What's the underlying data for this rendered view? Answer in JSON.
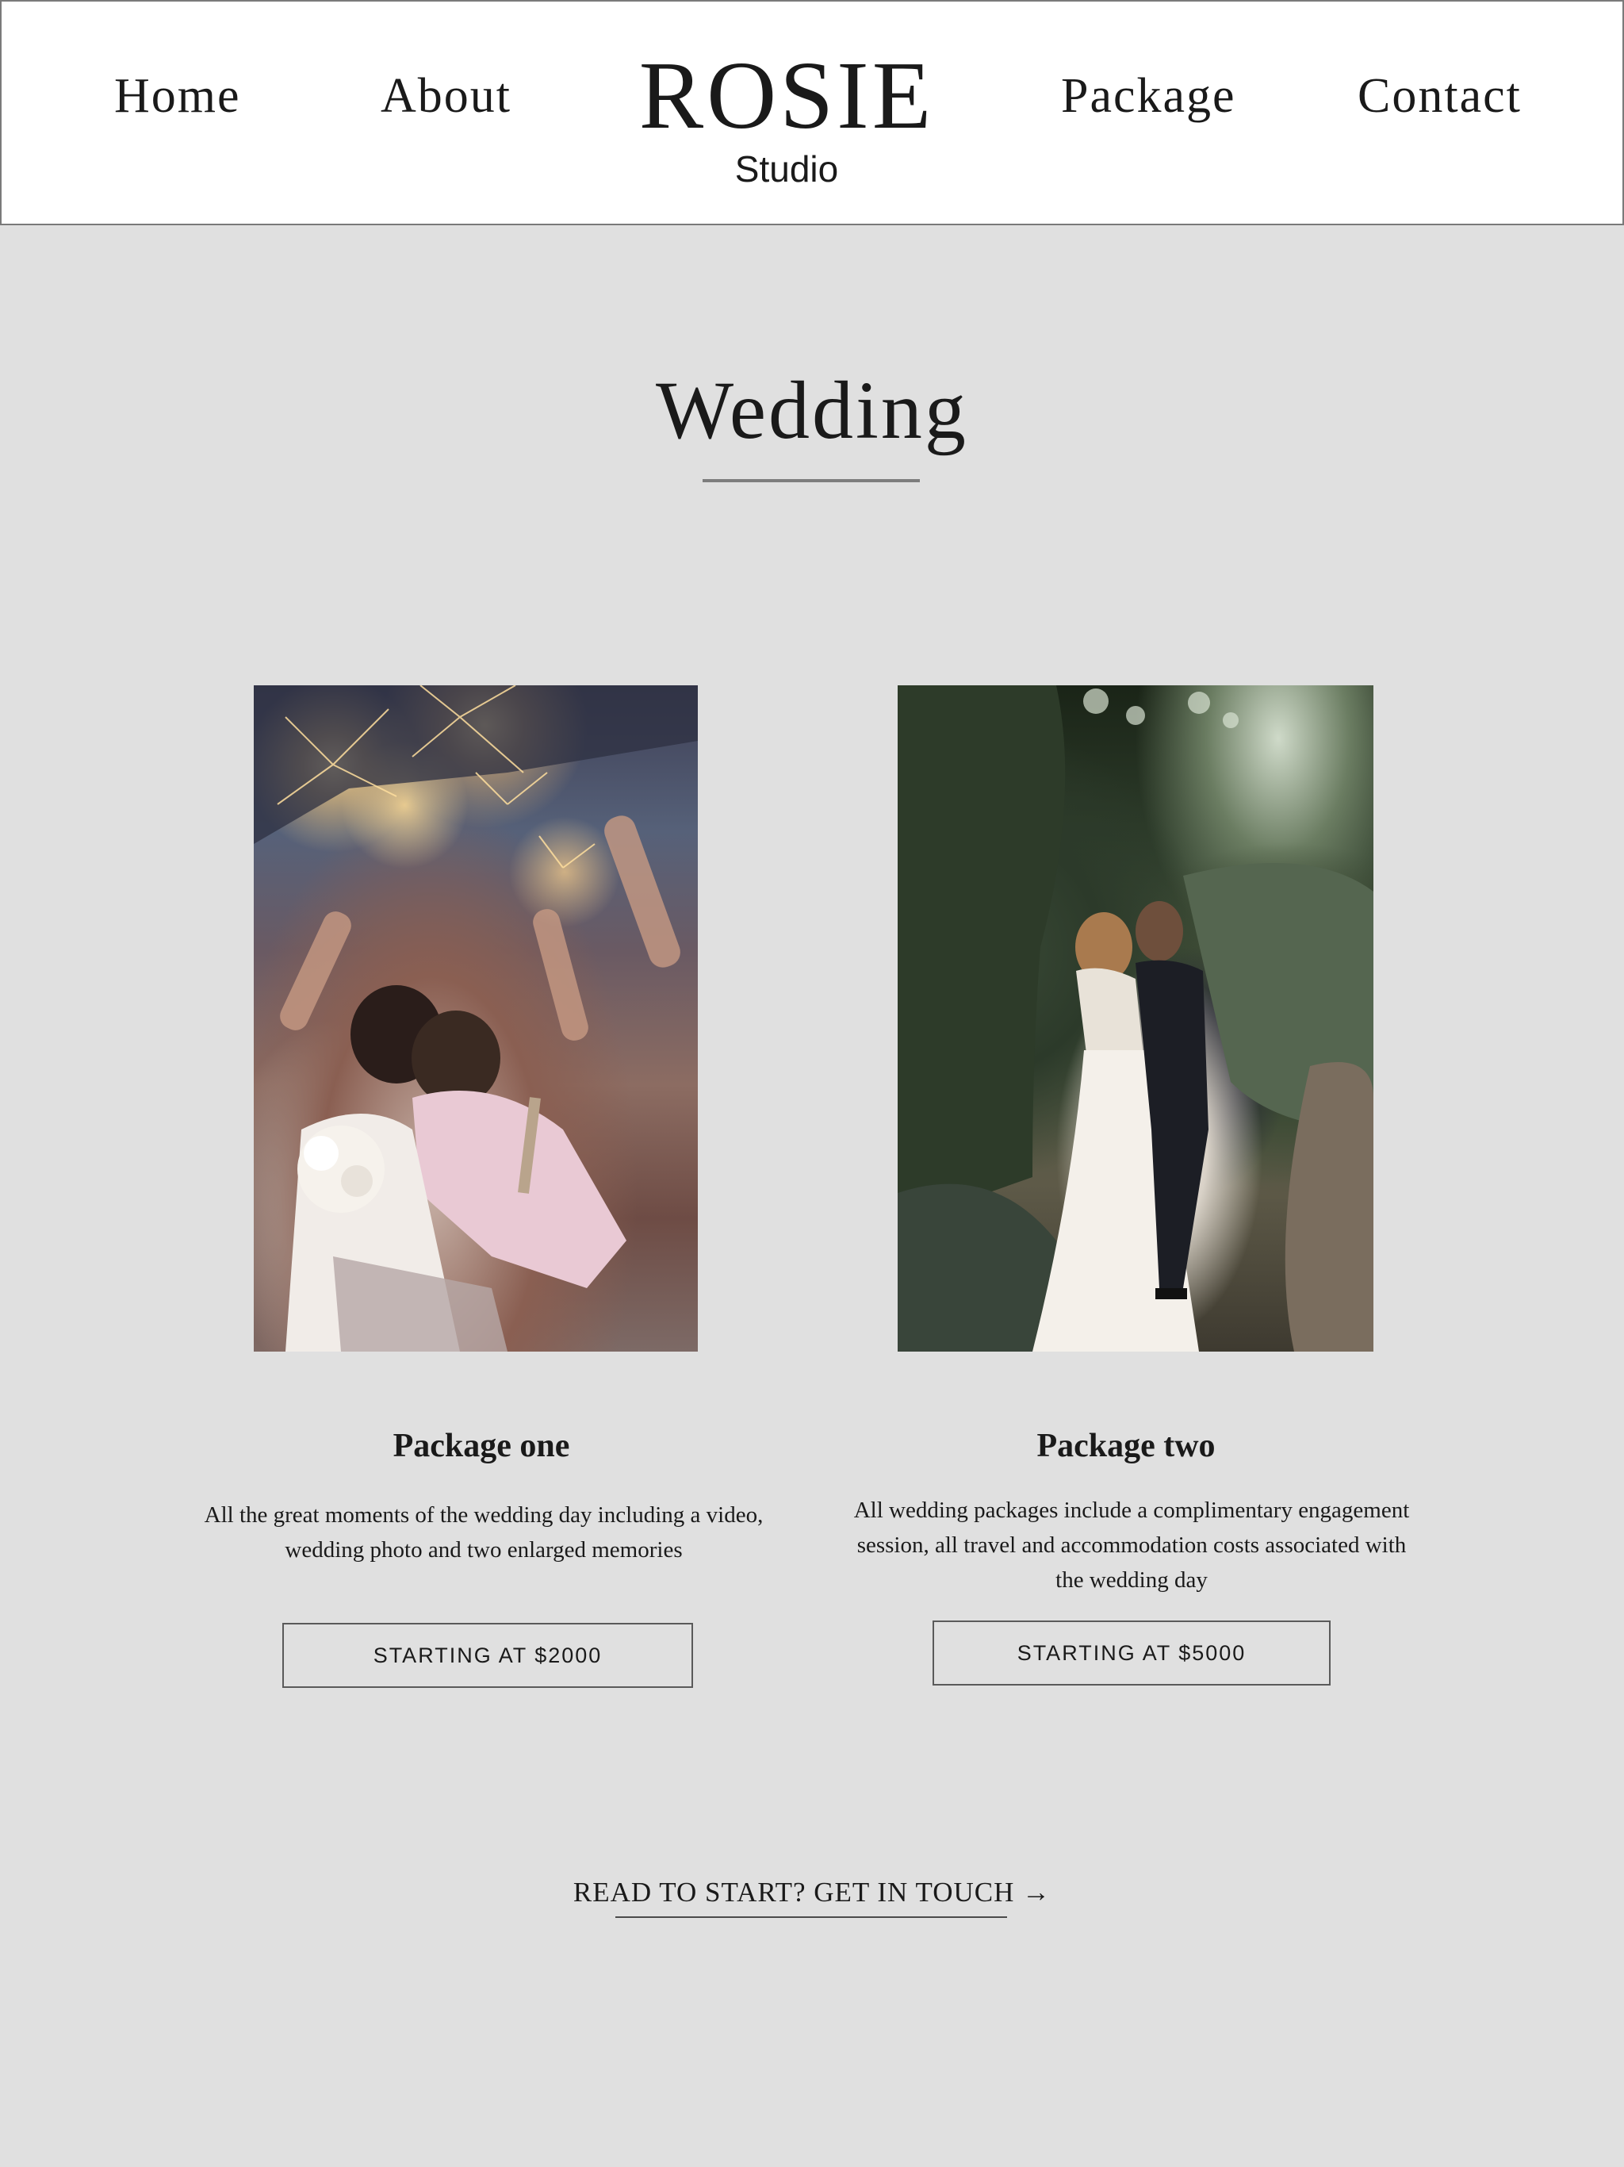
{
  "nav": {
    "home": "Home",
    "about": "About",
    "package": "Package",
    "contact": "Contact"
  },
  "logo": {
    "name": "ROSIE",
    "subtitle": "Studio"
  },
  "section": {
    "title": "Wedding"
  },
  "packages": [
    {
      "title": "Package one",
      "description": "All the great moments of the wedding day including a video, wedding photo and two enlarged memories",
      "button": "STARTING AT $2000"
    },
    {
      "title": "Package two",
      "description": "All wedding packages include a complimentary engagement session, all travel and accommodation costs associated with the wedding day",
      "button": "STARTING AT $5000"
    }
  ],
  "cta": {
    "label": "READ TO START? GET IN TOUCH →"
  },
  "colors": {
    "background": "#e0e0e0",
    "header_bg": "#ffffff",
    "text": "#1a1a1a",
    "rule": "#7d7d7d"
  }
}
